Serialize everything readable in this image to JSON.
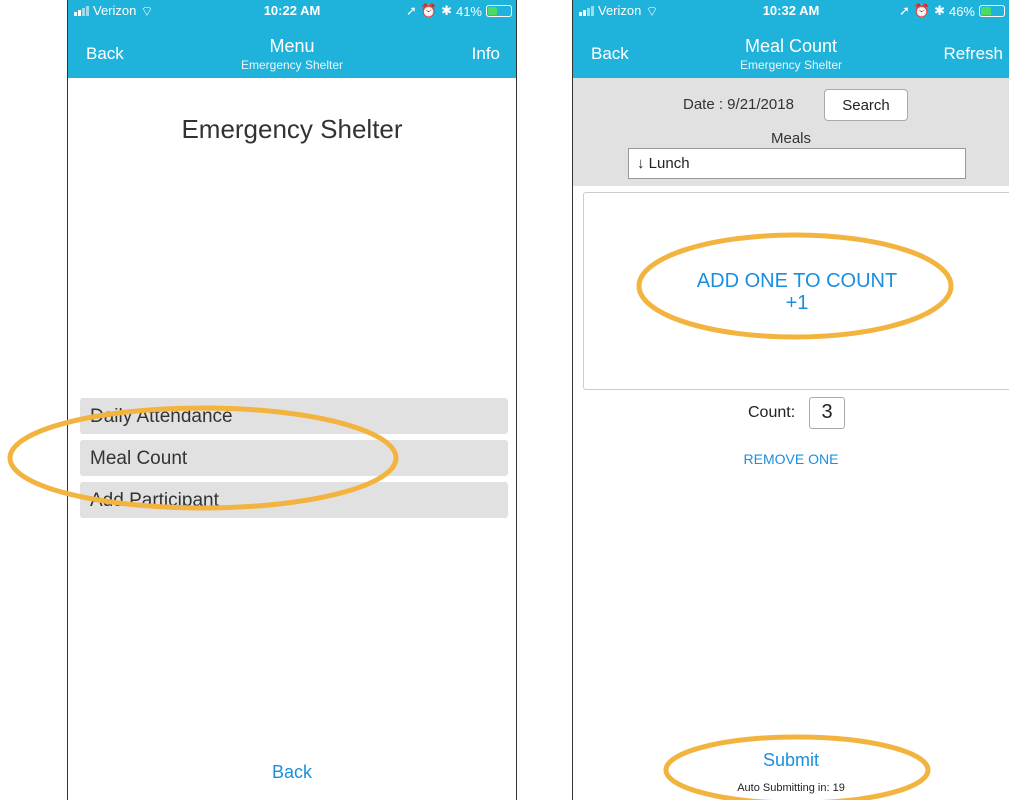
{
  "left_screen": {
    "status": {
      "carrier": "Verizon",
      "time": "10:22 AM",
      "battery": "41%",
      "battery_level": 0.41
    },
    "nav": {
      "left": "Back",
      "title": "Menu",
      "subtitle": "Emergency Shelter",
      "right": "Info"
    },
    "heading": "Emergency Shelter",
    "menu_items": [
      {
        "label": "Daily Attendance"
      },
      {
        "label": "Meal Count"
      },
      {
        "label": "Add Participant"
      }
    ],
    "bottom_back": "Back"
  },
  "right_screen": {
    "status": {
      "carrier": "Verizon",
      "time": "10:32 AM",
      "battery": "46%",
      "battery_level": 0.46
    },
    "nav": {
      "left": "Back",
      "title": "Meal Count",
      "subtitle": "Emergency Shelter",
      "right": "Refresh"
    },
    "date_label": "Date : 9/21/2018",
    "search_button": "Search",
    "meals_label": "Meals",
    "meal_select": "↓ Lunch",
    "add_one_label": "ADD ONE TO COUNT",
    "add_one_plus": "+1",
    "count_label": "Count:",
    "count_value": "3",
    "remove_one": "REMOVE ONE",
    "submit": "Submit",
    "auto_submit": "Auto Submitting in: 19"
  },
  "colors": {
    "nav_bar": "#1fb3dc",
    "link": "#1a8fe0",
    "highlight": "#f3b43f",
    "menu_item_bg": "#e1e1e1"
  }
}
